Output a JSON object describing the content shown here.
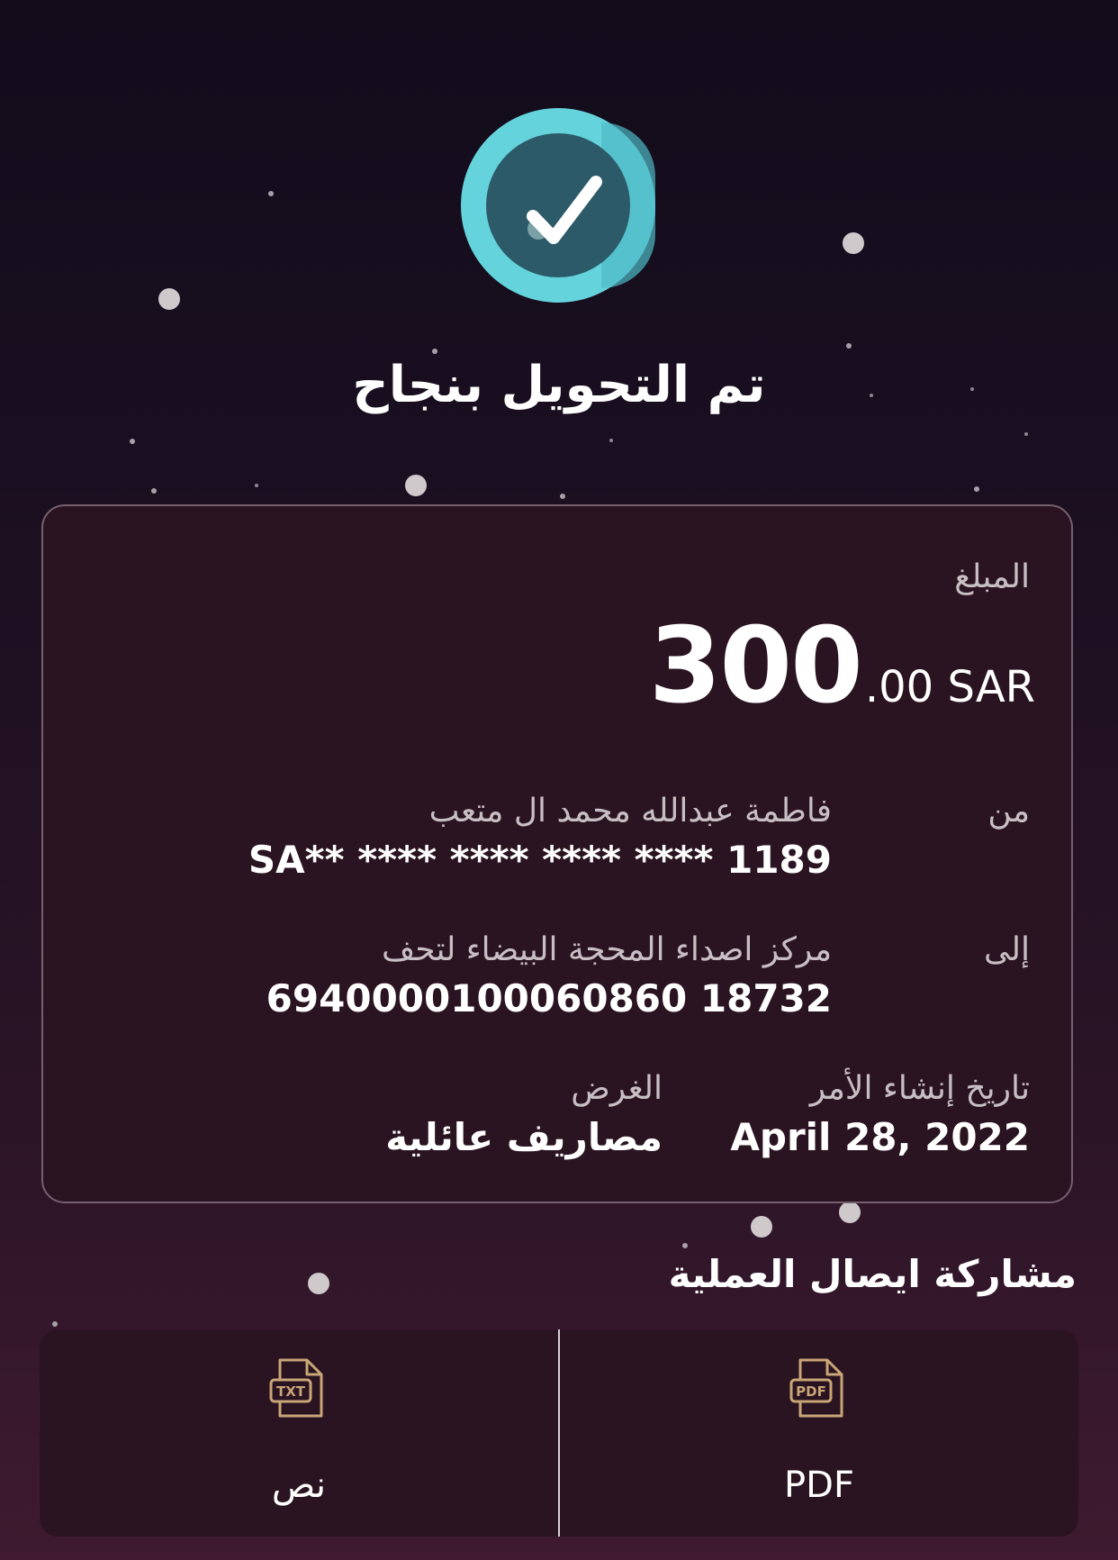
{
  "status": {
    "title": "تم التحويل بنجاح",
    "icon": "check-circle-icon",
    "accent": "#64d3dc"
  },
  "receipt": {
    "amount_label": "المبلغ",
    "amount_main": "300",
    "amount_rest": ".00 SAR",
    "from_label": "من",
    "from_name": "فاطمة عبدالله محمد ال متعب",
    "from_account": "SA** **** **** **** **** 1189",
    "to_label": "إلى",
    "to_name": "مركز اصداء المحجة البيضاء لتحف",
    "to_account": "6940000100060860 18732",
    "date_label": "تاريخ إنشاء الأمر",
    "date_value": "April 28, 2022",
    "purpose_label": "الغرض",
    "purpose_value": "مصاريف عائلية"
  },
  "share": {
    "title": "مشاركة ايصال العملية",
    "pdf_label": "PDF",
    "pdf_icon": "pdf-file-icon",
    "pdf_badge": "PDF",
    "text_label": "نص",
    "text_icon": "txt-file-icon",
    "text_badge": "TXT",
    "icon_color": "#c9a677"
  }
}
